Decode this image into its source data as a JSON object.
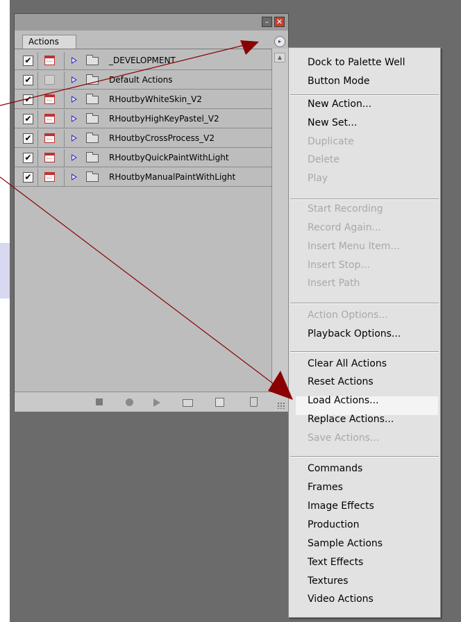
{
  "palette": {
    "tab_label": "Actions",
    "minimize_glyph": "–",
    "close_glyph": "✕",
    "menu_button_glyph": "▸",
    "scroll_up_glyph": "▲",
    "check_glyph": "✔",
    "actions": [
      {
        "label": "_DEVELOPMENT",
        "checked": true,
        "dialog": true
      },
      {
        "label": "Default Actions",
        "checked": true,
        "dialog": false
      },
      {
        "label": "RHoutbyWhiteSkin_V2",
        "checked": true,
        "dialog": true
      },
      {
        "label": "RHoutbyHighKeyPastel_V2",
        "checked": true,
        "dialog": true
      },
      {
        "label": "RHoutbyCrossProcess_V2",
        "checked": true,
        "dialog": true
      },
      {
        "label": "RHoutbyQuickPaintWithLight",
        "checked": true,
        "dialog": true
      },
      {
        "label": "RHoutbyManualPaintWithLight",
        "checked": true,
        "dialog": true
      }
    ],
    "bottom_icons": [
      "stop-icon",
      "record-icon",
      "play-icon",
      "new-set-icon",
      "new-action-icon",
      "trash-icon",
      "resize-grip-icon"
    ]
  },
  "menu": {
    "items": [
      {
        "label": "Dock to Palette Well",
        "enabled": true
      },
      {
        "label": "Button Mode",
        "enabled": true
      },
      {
        "label": "New Action...",
        "enabled": true
      },
      {
        "label": "New Set...",
        "enabled": true
      },
      {
        "label": "Duplicate",
        "enabled": false
      },
      {
        "label": "Delete",
        "enabled": false
      },
      {
        "label": "Play",
        "enabled": false
      },
      {
        "label": "Start Recording",
        "enabled": false
      },
      {
        "label": "Record Again...",
        "enabled": false
      },
      {
        "label": "Insert Menu Item...",
        "enabled": false
      },
      {
        "label": "Insert Stop...",
        "enabled": false
      },
      {
        "label": "Insert Path",
        "enabled": false
      },
      {
        "label": "Action Options...",
        "enabled": false
      },
      {
        "label": "Playback Options...",
        "enabled": true
      },
      {
        "label": "Clear All Actions",
        "enabled": true
      },
      {
        "label": "Reset Actions",
        "enabled": true
      },
      {
        "label": "Load Actions...",
        "enabled": true,
        "highlighted": true
      },
      {
        "label": "Replace Actions...",
        "enabled": true
      },
      {
        "label": "Save Actions...",
        "enabled": false
      },
      {
        "label": "Commands",
        "enabled": true
      },
      {
        "label": "Frames",
        "enabled": true
      },
      {
        "label": "Image Effects",
        "enabled": true
      },
      {
        "label": "Production",
        "enabled": true
      },
      {
        "label": "Sample Actions",
        "enabled": true
      },
      {
        "label": "Text Effects",
        "enabled": true
      },
      {
        "label": "Textures",
        "enabled": true
      },
      {
        "label": "Video Actions",
        "enabled": true
      }
    ]
  },
  "annotation": {
    "arrow_color": "#8b0000"
  }
}
